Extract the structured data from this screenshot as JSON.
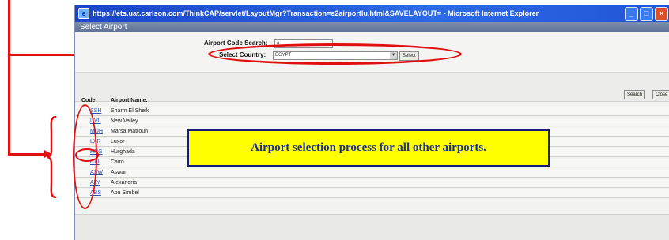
{
  "window": {
    "title": "https://ets.uat.carlson.com/ThinkCAP/servlet/LayoutMgr?Transaction=e2airportlu.html&SAVELAYOUT= - Microsoft Internet Explorer",
    "controls": [
      "_",
      "□",
      "×"
    ]
  },
  "page": {
    "heading": "Select Airport",
    "airport_code_search_label": "Airport Code Search:",
    "airport_code_value": "a",
    "select_country_label": "Select Country:",
    "country_value": "EGYPT",
    "select_button": "Select",
    "search_button": "Search",
    "close_button": "Close"
  },
  "table": {
    "headers": {
      "code": "Code:",
      "name": "Airport Name:"
    },
    "rows": [
      {
        "code": "SSH",
        "name": "Sharm El Sheik"
      },
      {
        "code": "UVL",
        "name": "New Valley"
      },
      {
        "code": "MUH",
        "name": "Marsa Matrouh"
      },
      {
        "code": "LXR",
        "name": "Luxor"
      },
      {
        "code": "HRG",
        "name": "Hurghada"
      },
      {
        "code": "CAI",
        "name": "Cairo"
      },
      {
        "code": "ASW",
        "name": "Aswan"
      },
      {
        "code": "ALY",
        "name": "Alexandria"
      },
      {
        "code": "ABS",
        "name": "Abu Simbel"
      }
    ]
  },
  "annotation": {
    "callout_text": "Airport selection process for all other airports.",
    "color": "#e01010",
    "callout_bg": "#ffff00",
    "callout_text_color": "#1a2d9a"
  }
}
